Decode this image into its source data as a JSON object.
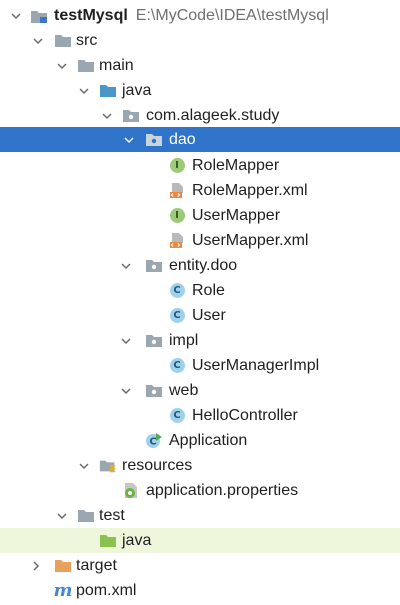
{
  "project": {
    "name": "testMysql",
    "path": "E:\\MyCode\\IDEA\\testMysql"
  },
  "tree": {
    "src": "src",
    "main": "main",
    "java": "java",
    "package": "com.alageek.study",
    "dao": "dao",
    "role_mapper": "RoleMapper",
    "role_mapper_xml": "RoleMapper.xml",
    "user_mapper": "UserMapper",
    "user_mapper_xml": "UserMapper.xml",
    "entity": "entity.doo",
    "role": "Role",
    "user": "User",
    "impl": "impl",
    "user_manager_impl": "UserManagerImpl",
    "web": "web",
    "hello_controller": "HelloController",
    "application": "Application",
    "resources": "resources",
    "app_properties": "application.properties",
    "test": "test",
    "test_java": "java",
    "target": "target",
    "pom": "pom.xml"
  },
  "icons": {
    "class_letter": "C",
    "interface_letter": "I",
    "maven_letter": "m"
  },
  "colors": {
    "selection": "#2f74c9",
    "folder": "#9aa7b0",
    "source_folder": "#4a97c9",
    "test_folder": "#8cc152",
    "excluded_folder": "#e8a15d",
    "test_band": "#eef6dc"
  }
}
